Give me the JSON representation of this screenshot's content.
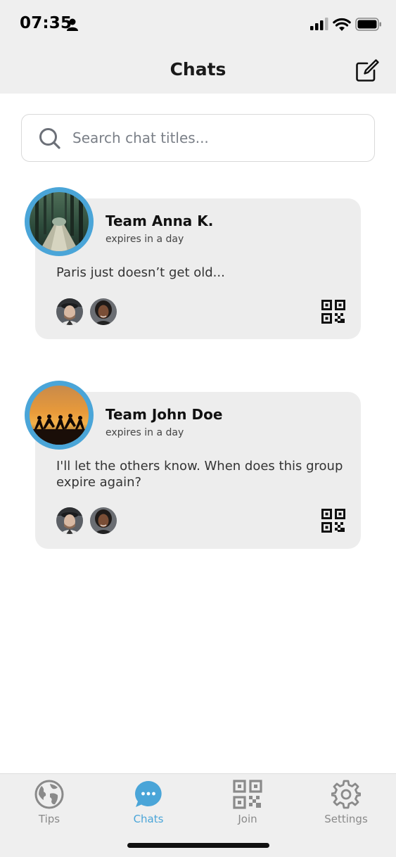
{
  "status_bar": {
    "time": "07:35",
    "icons": [
      "person-icon",
      "signal-icon",
      "wifi-icon",
      "battery-icon"
    ]
  },
  "nav": {
    "title": "Chats",
    "compose_icon": "compose-icon"
  },
  "search": {
    "placeholder": "Search chat titles...",
    "value": "",
    "icon": "search-icon"
  },
  "chats": [
    {
      "title": "Team Anna K.",
      "expiry": "expires in a day",
      "message": "Paris just doesn’t get old...",
      "members": [
        "member-avatar-man",
        "member-avatar-woman"
      ],
      "qr_icon": "qr-code-icon"
    },
    {
      "title": "Team John Doe",
      "expiry": "expires in a day",
      "message": "I'll let the others know. When does this group expire again?",
      "members": [
        "member-avatar-man",
        "member-avatar-woman"
      ],
      "qr_icon": "qr-code-icon"
    }
  ],
  "tabs": [
    {
      "label": "Tips",
      "icon": "globe-icon",
      "active": false
    },
    {
      "label": "Chats",
      "icon": "chat-bubble-icon",
      "active": true
    },
    {
      "label": "Join",
      "icon": "qr-code-icon",
      "active": false
    },
    {
      "label": "Settings",
      "icon": "gear-icon",
      "active": false
    }
  ],
  "colors": {
    "accent": "#4aa5d8",
    "bar_background": "#efefef",
    "card_background": "#ededed",
    "inactive_tab": "#8a8a8a"
  }
}
